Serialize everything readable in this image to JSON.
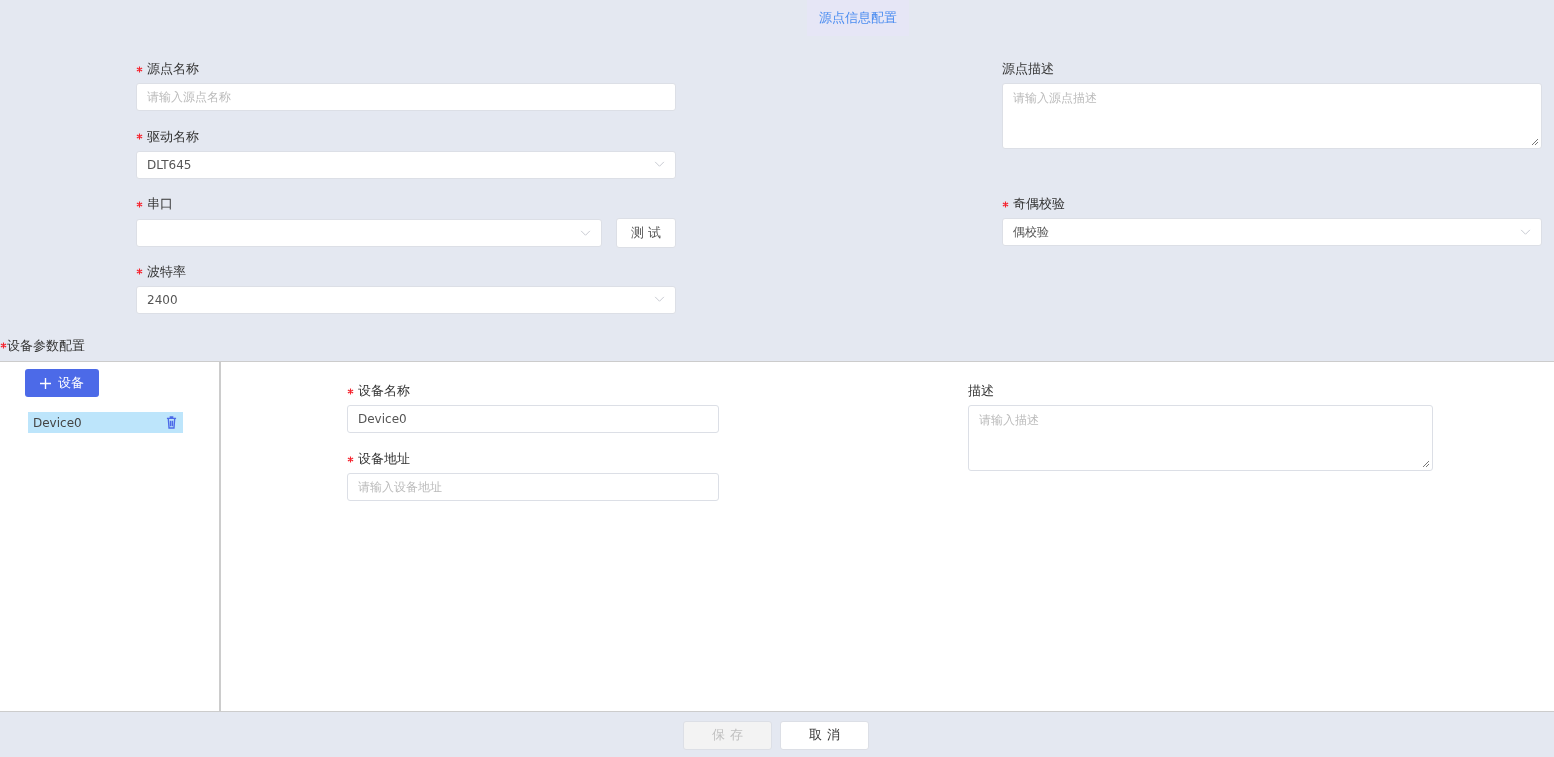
{
  "title_tab": {
    "label": "源点信息配置",
    "selected": true
  },
  "source_form": {
    "left": [
      {
        "kind": "input",
        "label": "源点名称",
        "required": true,
        "placeholder": "请输入源点名称"
      },
      {
        "kind": "select",
        "label": "驱动名称",
        "required": true,
        "value": "DLT645"
      },
      {
        "kind": "select",
        "label": "串口",
        "required": true,
        "button": "测 试"
      },
      {
        "kind": "select",
        "label": "波特率",
        "required": true,
        "value": "2400"
      }
    ],
    "right": [
      {
        "kind": "textarea",
        "label": "源点描述",
        "required": false,
        "placeholder": "请输入源点描述"
      },
      {
        "kind": "select",
        "label": "奇偶校验",
        "required": true,
        "value": "偶校验"
      }
    ]
  },
  "device_section": {
    "label": "设备参数配置",
    "required": true
  },
  "device_list": {
    "add_button": "设备",
    "items": [
      {
        "name": "Device0",
        "selected": true
      }
    ]
  },
  "device_form": {
    "left": [
      {
        "kind": "input",
        "label": "设备名称",
        "required": true,
        "value": "Device0"
      },
      {
        "kind": "input",
        "label": "设备地址",
        "required": true,
        "placeholder": "请输入设备地址"
      }
    ],
    "right": [
      {
        "kind": "textarea",
        "label": "描述",
        "required": false,
        "placeholder": "请输入描述"
      }
    ]
  },
  "footer": {
    "buttons": [
      {
        "label": "保 存",
        "disabled": true
      },
      {
        "label": "取 消",
        "disabled": false
      }
    ]
  }
}
